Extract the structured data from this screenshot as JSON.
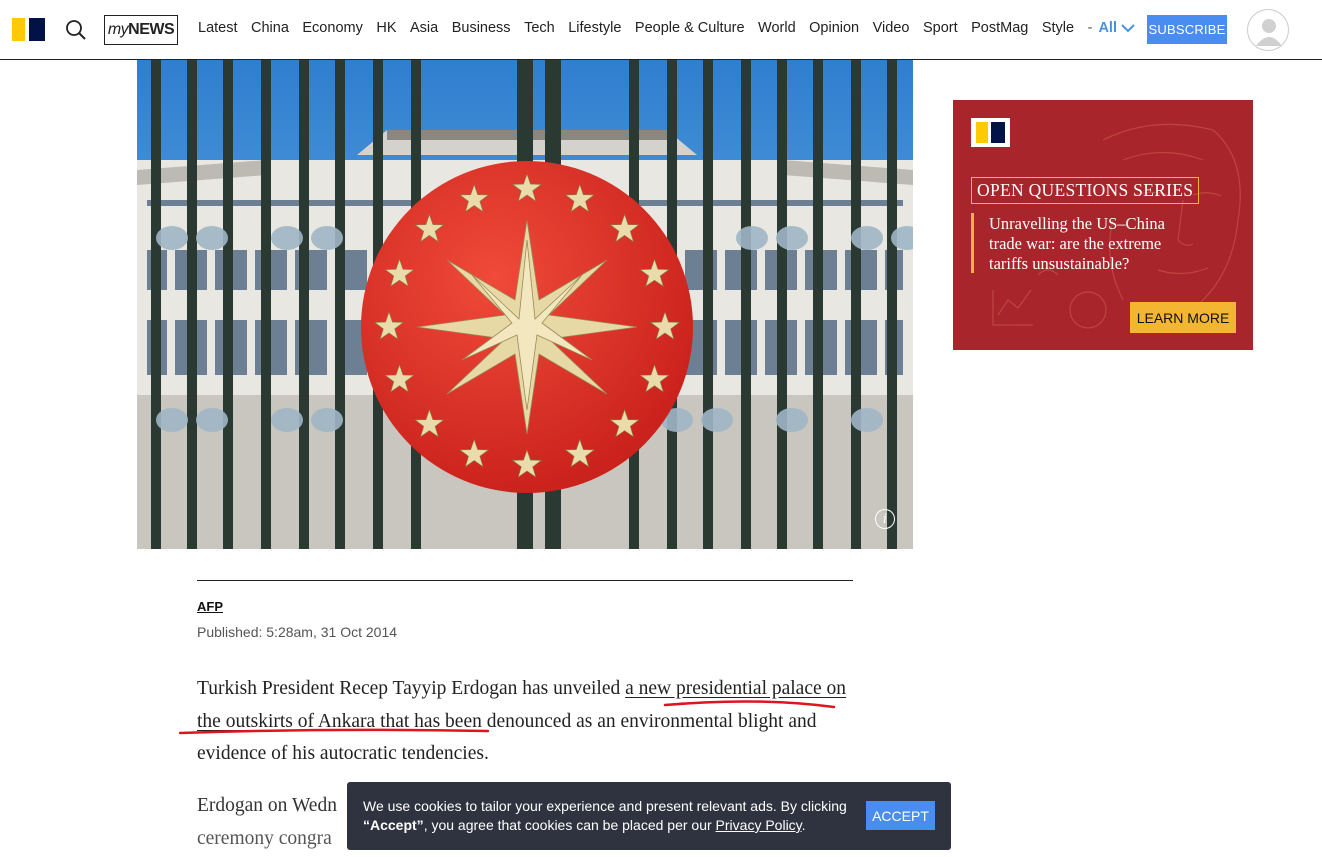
{
  "header": {
    "mynews_my": "my",
    "mynews_news": "NEWS",
    "nav": [
      "Latest",
      "China",
      "Economy",
      "HK",
      "Asia",
      "Business",
      "Tech",
      "Lifestyle",
      "People & Culture",
      "World",
      "Opinion",
      "Video",
      "Sport",
      "PostMag",
      "Style"
    ],
    "nav_dash": "-",
    "nav_all": "All",
    "subscribe_label": "SUBSCRIBE",
    "icons": {
      "search": "search-icon",
      "chevron": "chevron-down-icon",
      "avatar": "user-avatar-icon"
    }
  },
  "hero": {
    "info_icon_label": "i"
  },
  "article": {
    "author": "AFP",
    "published": "Published: 5:28am, 31 Oct 2014",
    "paragraph1": {
      "before": "Turkish President Recep Tayyip Erdogan has unveiled ",
      "link": "a new presidential palace on the outskirts of Ankara",
      "after": " that has been denounced as an environmental blight and evidence of his autocratic tendencies."
    },
    "paragraph2_start": "Erdogan on Wedn",
    "paragraph2_line2": "ceremony congra"
  },
  "ad": {
    "series_label": "OPEN QUESTIONS SERIES",
    "headline": "Unravelling the US–China trade war: are the extreme tariffs unsustainable?",
    "cta": "LEARN MORE"
  },
  "cookie": {
    "text_before": "We use cookies to tailor your experience and present relevant ads. By clicking ",
    "text_bold": "“Accept”",
    "text_middle": ", you agree that cookies can be placed per our ",
    "link": "Privacy Policy",
    "text_after": ".",
    "accept_label": "ACCEPT"
  },
  "colors": {
    "brand_yellow": "#ffca05",
    "brand_navy": "#001246",
    "accent_blue": "#4a8df0",
    "ad_red": "#a8262b",
    "ad_gold": "#f2b632",
    "annotation_red": "#e0141e"
  }
}
